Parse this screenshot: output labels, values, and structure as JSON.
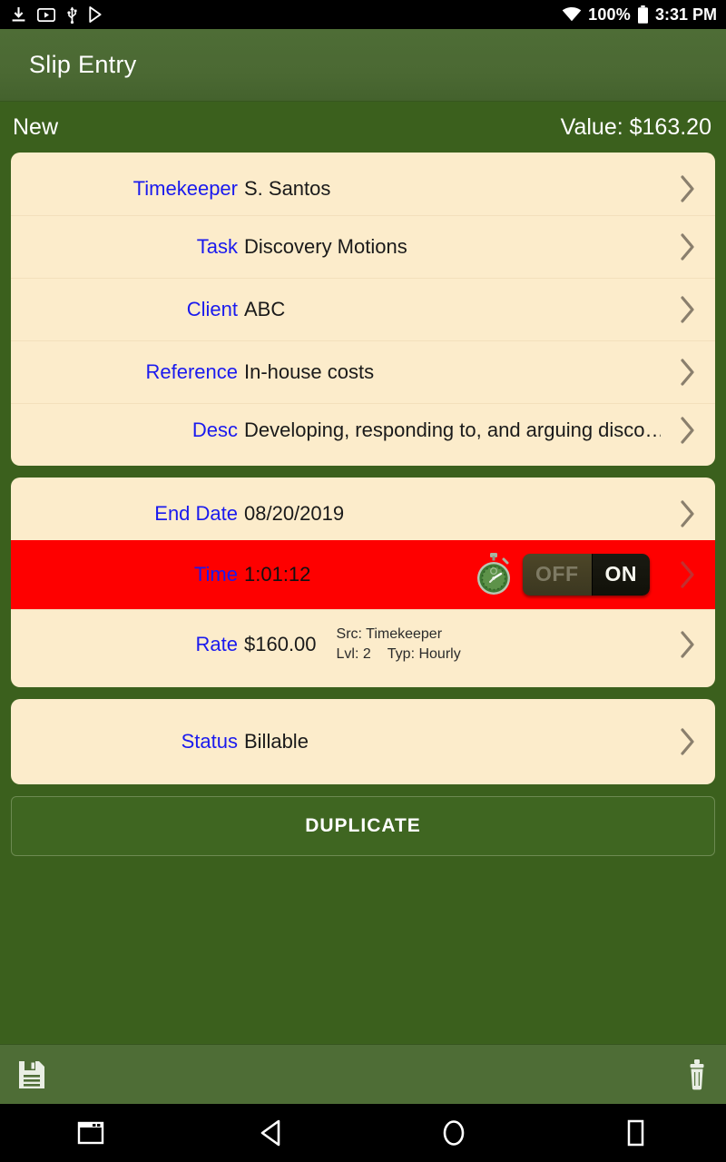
{
  "status_bar": {
    "left_icons": [
      "download-icon",
      "video-icon",
      "usb-icon",
      "play-store-icon"
    ],
    "wifi_icon": "wifi-icon",
    "battery_percent": "100%",
    "battery_icon": "battery-full-icon",
    "time": "3:31 PM"
  },
  "app_bar": {
    "title": "Slip Entry"
  },
  "sub_header": {
    "state": "New",
    "value": "Value: $163.20"
  },
  "cards": [
    {
      "rows": [
        {
          "label": "Timekeeper",
          "value": "S. Santos",
          "chevron": "chevron-right-icon"
        },
        {
          "label": "Task",
          "value": "Discovery Motions",
          "chevron": "chevron-right-icon"
        },
        {
          "label": "Client",
          "value": "ABC",
          "chevron": "chevron-right-icon"
        },
        {
          "label": "Reference",
          "value": "In-house costs",
          "chevron": "chevron-right-icon"
        },
        {
          "label": "Desc",
          "value": "Developing, responding to, and arguing disco…",
          "chevron": "chevron-right-icon"
        }
      ]
    },
    {
      "rows": [
        {
          "label": "End Date",
          "value": "08/20/2019",
          "chevron": "chevron-right-icon"
        },
        {
          "label": "Time",
          "value": "1:01:12",
          "chevron": "chevron-right-icon",
          "highlighted": true,
          "timer_icon": "stopwatch-icon",
          "toggle": {
            "off_label": "OFF",
            "on_label": "ON",
            "selected": "ON"
          }
        },
        {
          "label": "Rate",
          "value": "$160.00",
          "chevron": "chevron-right-icon",
          "meta_source": "Src: Timekeeper",
          "meta_level": "Lvl: 2",
          "meta_type": "Typ: Hourly"
        }
      ]
    },
    {
      "rows": [
        {
          "label": "Status",
          "value": "Billable",
          "chevron": "chevron-right-icon"
        }
      ]
    }
  ],
  "duplicate_button": {
    "label": "DUPLICATE"
  },
  "bottom_bar": {
    "save_icon": "save-icon",
    "delete_icon": "trash-icon"
  },
  "nav_bar": {
    "items": [
      "recents-window-icon",
      "back-icon",
      "home-icon",
      "overview-icon"
    ]
  },
  "colors": {
    "app_bar_green": "#4e6d36",
    "background_green": "#3b601d",
    "card_cream": "#fceccb",
    "label_blue": "#1a1aee",
    "highlight_red": "#fe0000",
    "toggle_on_bg": "#141410",
    "toggle_off_bg": "#463f24"
  }
}
